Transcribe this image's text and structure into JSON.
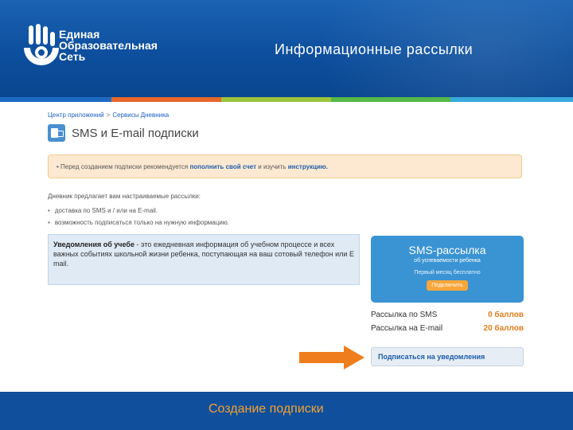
{
  "header": {
    "logo_lines": [
      "Единая",
      "Образовательная",
      "Сеть"
    ],
    "title": "Информационные рассылки"
  },
  "strip_colors": [
    "#1f6bc4",
    "#e8672a",
    "#9bc43a",
    "#f0b92e",
    "#57b847",
    "#39a9dc",
    "#f3c22b"
  ],
  "breadcrumb": {
    "item1": "Центр приложений",
    "sep": ">",
    "item2": "Сервисы Дневника"
  },
  "page": {
    "title": "SMS и E-mail подписки"
  },
  "notice": {
    "prefix": "• Перед созданием подписки рекомендуется",
    "link1": "пополнить свой счет",
    "middle": "и изучить",
    "link2": "инструкцию."
  },
  "intro": "Дневник предлагает вам настраиваемые рассылки:",
  "bullets": [
    "доставка по SMS и / или на E-mail.",
    "возможность подписаться только на нужную информацию."
  ],
  "info_box": {
    "bold": "Уведомления об учебе",
    "text": " - это ежедневная информация об учебном процессе и всех важных событиях школьной жизни ребенка, поступающая на ваш сотовый телефон или E mail."
  },
  "sms_card": {
    "title": "SMS-рассылка",
    "subtitle": "об успеваемости ребенка",
    "free": "Первый месяц бесплатно",
    "button": "Подключить"
  },
  "prices": [
    {
      "label": "Рассылка по SMS",
      "value": "0 баллов"
    },
    {
      "label": "Рассылка на E-mail",
      "value": "20 баллов"
    }
  ],
  "subscribe_link": "Подписаться на уведомления",
  "footer": {
    "caption": "Создание подписки"
  },
  "colors": {
    "header_bg": "#0d4f9e",
    "accent_orange": "#f07d1b",
    "footer_text": "#f4a233"
  }
}
